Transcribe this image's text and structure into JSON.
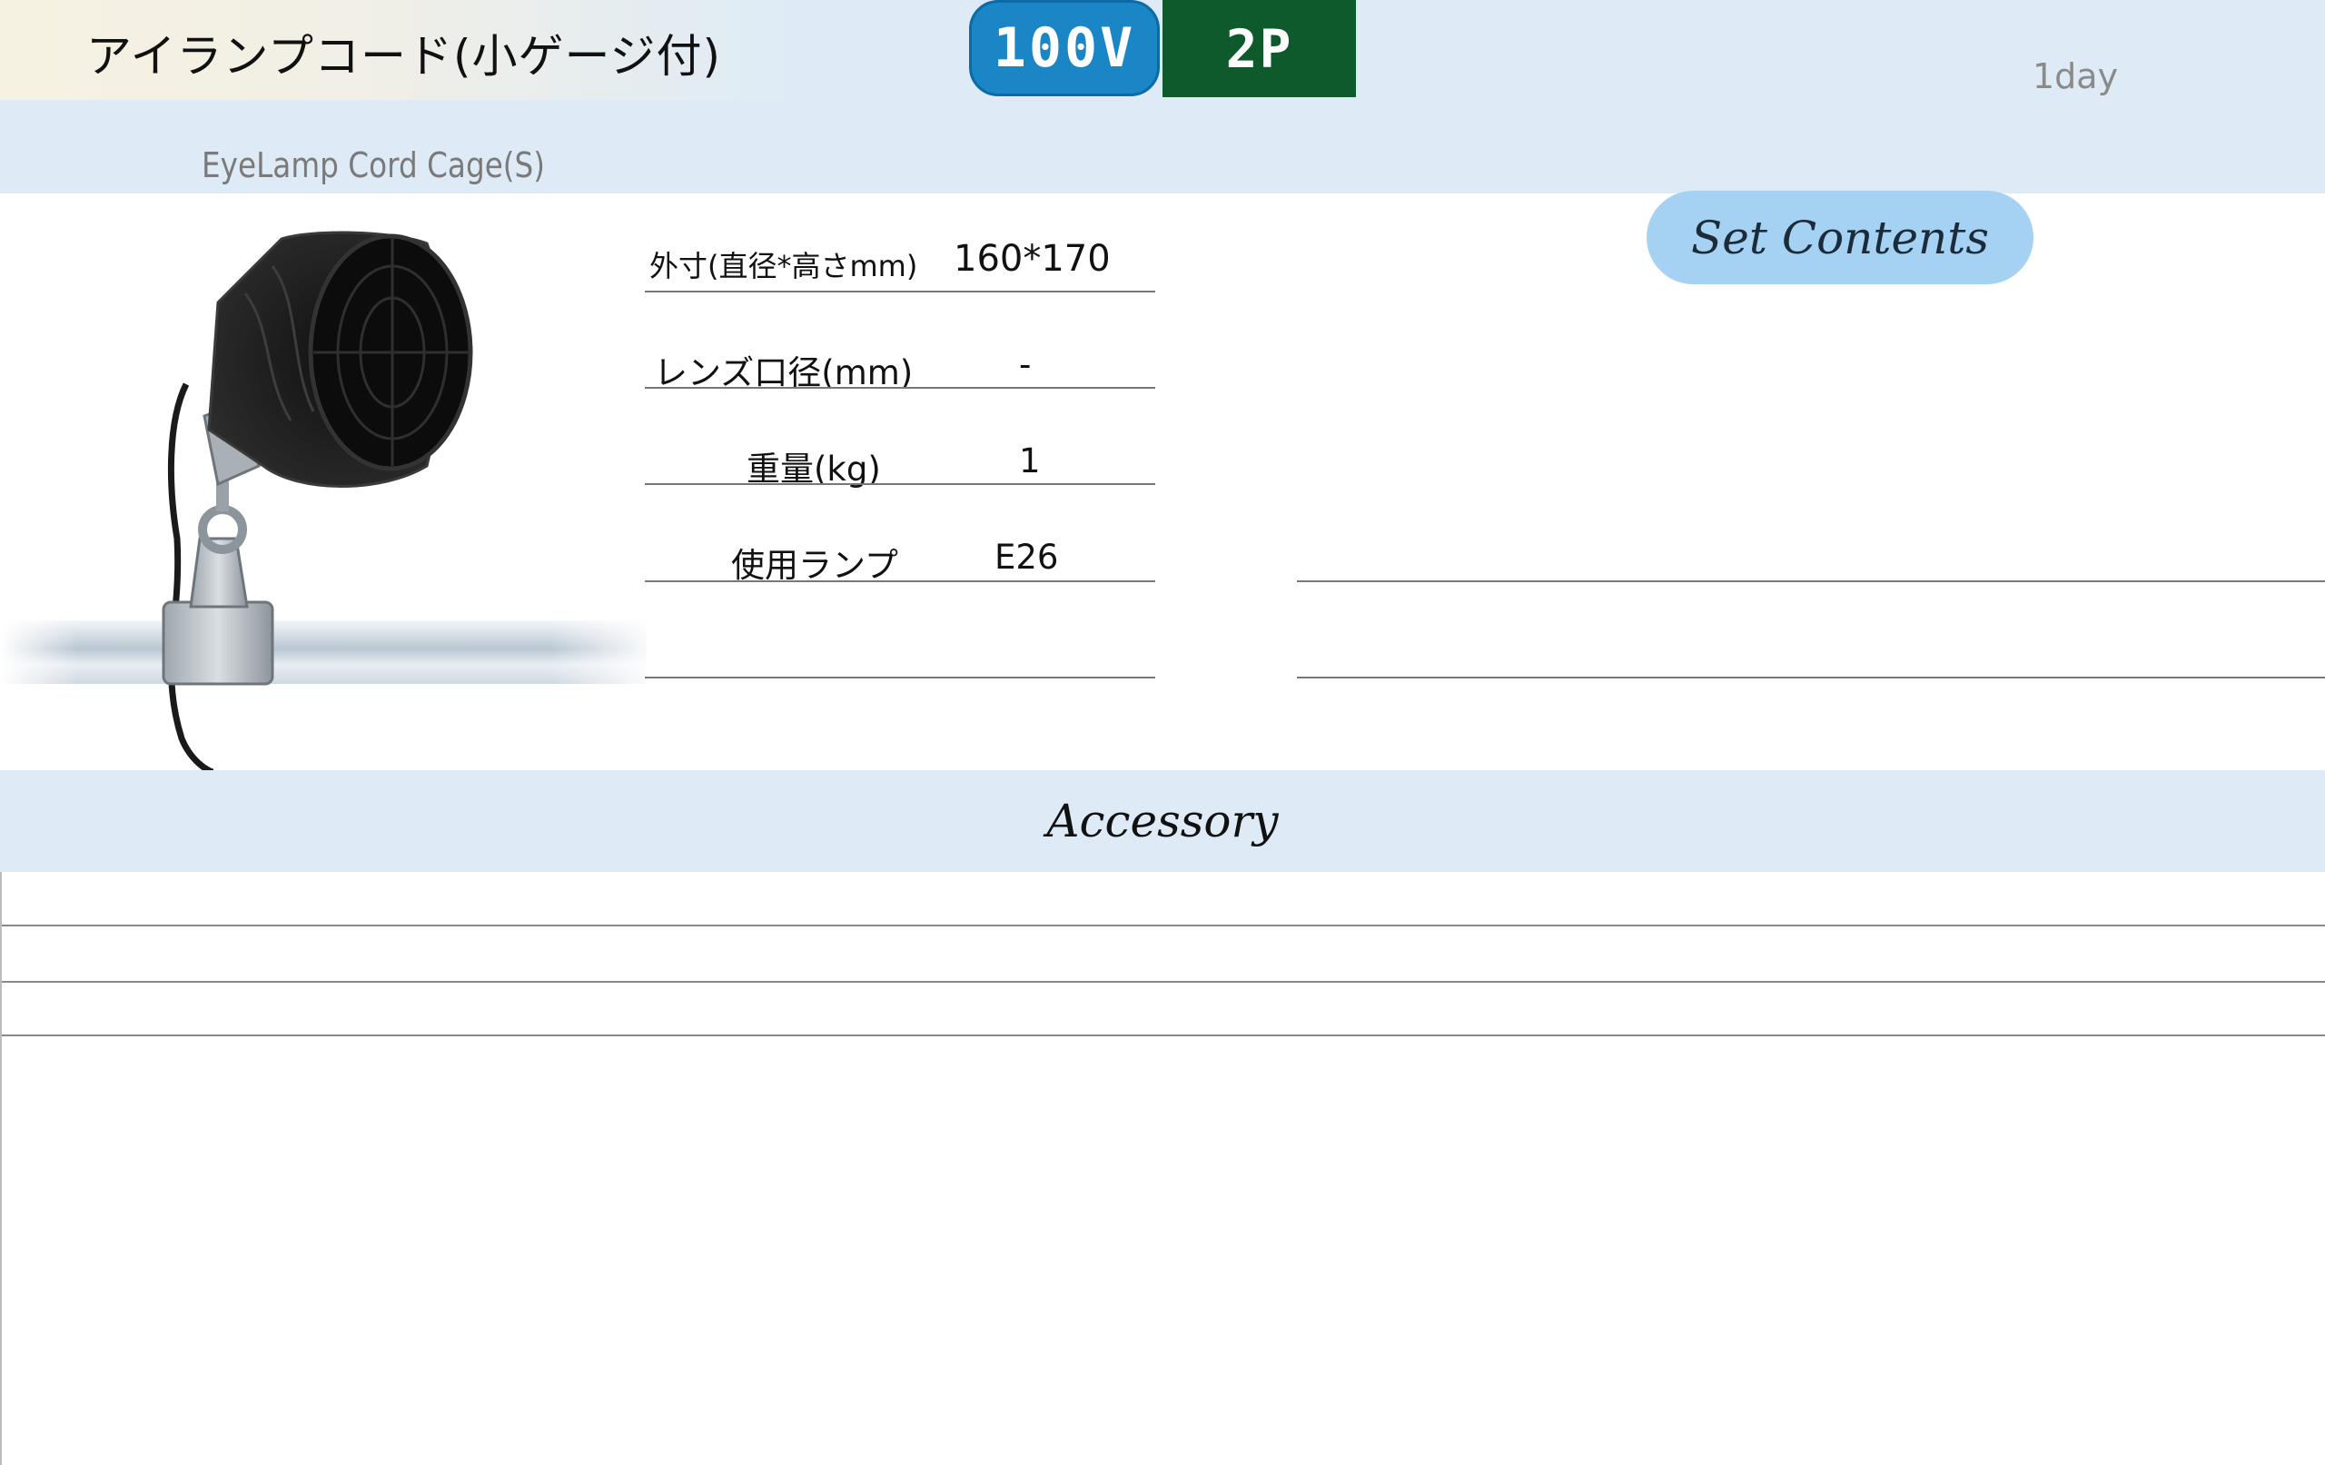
{
  "header": {
    "title": "アイランプコード(小ゲージ付)",
    "subtitle": "EyeLamp Cord Cage(S)",
    "voltage_badge": "100V",
    "plug_badge": "2P",
    "duration": "1day"
  },
  "set_contents": {
    "label": "Set Contents"
  },
  "specs": [
    {
      "label": "外寸(直径*高さmm)",
      "value": "160*170"
    },
    {
      "label": "レンズ口径(mm)",
      "value": "-"
    },
    {
      "label": "重量(kg)",
      "value": "1"
    },
    {
      "label": "使用ランプ",
      "value": "E26"
    }
  ],
  "accessory": {
    "title": "Accessory"
  },
  "colors": {
    "header_band": "#deebf6",
    "voltage_badge": "#1b86c6",
    "plug_badge": "#0e5a2c",
    "set_pill": "#a5d1f3"
  },
  "icons": [
    "eye-lamp-product-photo"
  ]
}
